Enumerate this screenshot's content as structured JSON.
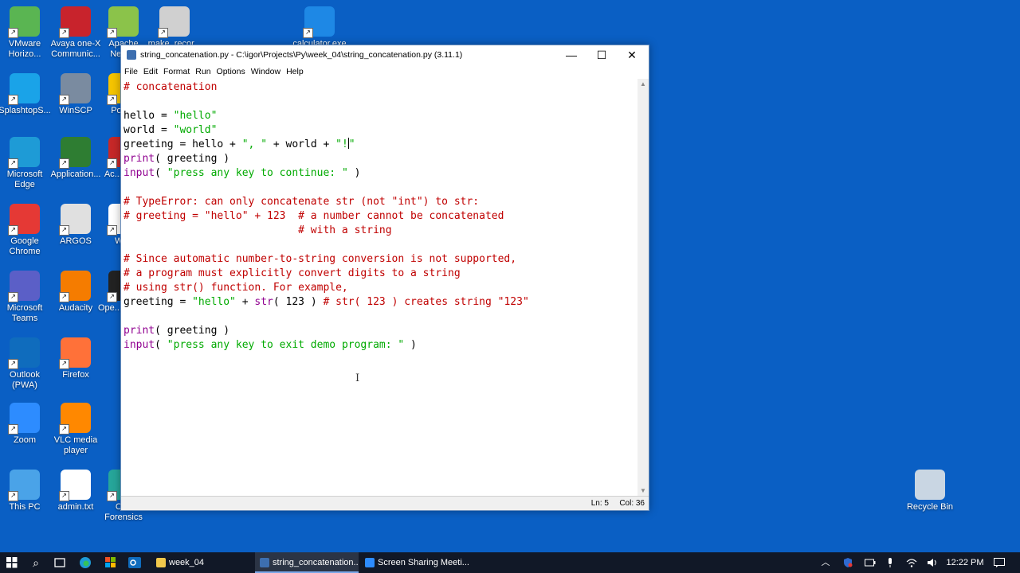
{
  "desktop": {
    "icons": [
      {
        "label": "VMware Horizo...",
        "color": "#5ab552"
      },
      {
        "label": "Avaya one-X Communic...",
        "color": "#c8232c"
      },
      {
        "label": "Apache NetB...",
        "color": "#8bc34a"
      },
      {
        "label": "make_recor...",
        "color": "#d0d0d0"
      },
      {
        "label": "calculator.exe",
        "color": "#1e88e5"
      },
      {
        "label": "SplashtopS...",
        "color": "#1aa3e8"
      },
      {
        "label": "WinSCP",
        "color": "#7a8ba0"
      },
      {
        "label": "PotP...",
        "color": "#f5c400"
      },
      {
        "label": "Microsoft Edge",
        "color": "#1e9bd6"
      },
      {
        "label": "Application...",
        "color": "#2e7d32"
      },
      {
        "label": "Ac... Re...",
        "color": "#c62828"
      },
      {
        "label": "Google Chrome",
        "color": "#e53935"
      },
      {
        "label": "ARGOS",
        "color": "#e0e0e0"
      },
      {
        "label": "Wi...",
        "color": "#ffffff"
      },
      {
        "label": "Microsoft Teams",
        "color": "#5b5fc7"
      },
      {
        "label": "Audacity",
        "color": "#f57c00"
      },
      {
        "label": "Ope... Vide...",
        "color": "#222222"
      },
      {
        "label": "Outlook (PWA)",
        "color": "#0f6cbd"
      },
      {
        "label": "Firefox",
        "color": "#ff7139"
      },
      {
        "label": "Zoom",
        "color": "#2d8cff"
      },
      {
        "label": "VLC media player",
        "color": "#ff8800"
      },
      {
        "label": "This PC",
        "color": "#4aa3e8"
      },
      {
        "label": "admin.txt",
        "color": "#ffffff"
      },
      {
        "label": "CI... Forensics",
        "color": "#26a69a"
      },
      {
        "label": "Recycle Bin",
        "color": "#c9d6e3"
      }
    ]
  },
  "window": {
    "title": "string_concatenation.py - C:\\igor\\Projects\\Py\\week_04\\string_concatenation.py (3.11.1)",
    "minimize": "—",
    "maximize": "☐",
    "close": "✕",
    "menu": [
      "File",
      "Edit",
      "Format",
      "Run",
      "Options",
      "Window",
      "Help"
    ]
  },
  "code_lines": [
    [
      {
        "t": "cm",
        "s": "# concatenation"
      }
    ],
    [],
    [
      {
        "t": "",
        "s": "hello = "
      },
      {
        "t": "st",
        "s": "\"hello\""
      }
    ],
    [
      {
        "t": "",
        "s": "world = "
      },
      {
        "t": "st",
        "s": "\"world\""
      }
    ],
    [
      {
        "t": "",
        "s": "greeting = hello + "
      },
      {
        "t": "st",
        "s": "\", \""
      },
      {
        "t": "",
        "s": " + world + "
      },
      {
        "t": "st",
        "s": "\"!"
      },
      {
        "t": "caret",
        "s": ""
      },
      {
        "t": "st",
        "s": "\""
      }
    ],
    [
      {
        "t": "bi",
        "s": "print"
      },
      {
        "t": "",
        "s": "( greeting )"
      }
    ],
    [
      {
        "t": "bi",
        "s": "input"
      },
      {
        "t": "",
        "s": "( "
      },
      {
        "t": "st",
        "s": "\"press any key to continue: \""
      },
      {
        "t": "",
        "s": " )"
      }
    ],
    [],
    [
      {
        "t": "cm",
        "s": "# TypeError: can only concatenate str (not \"int\") to str:"
      }
    ],
    [
      {
        "t": "cm",
        "s": "# greeting = \"hello\" + 123  # a number cannot be concatenated"
      }
    ],
    [
      {
        "t": "cm",
        "s": "                            # with a string"
      }
    ],
    [],
    [
      {
        "t": "cm",
        "s": "# Since automatic number-to-string conversion is not supported,"
      }
    ],
    [
      {
        "t": "cm",
        "s": "# a program must explicitly convert digits to a string"
      }
    ],
    [
      {
        "t": "cm",
        "s": "# using str() function. For example,"
      }
    ],
    [
      {
        "t": "",
        "s": "greeting = "
      },
      {
        "t": "st",
        "s": "\"hello\""
      },
      {
        "t": "",
        "s": " + "
      },
      {
        "t": "bi",
        "s": "str"
      },
      {
        "t": "",
        "s": "( 123 ) "
      },
      {
        "t": "cm",
        "s": "# str( 123 ) creates string \"123\""
      }
    ],
    [],
    [
      {
        "t": "bi",
        "s": "print"
      },
      {
        "t": "",
        "s": "( greeting )"
      }
    ],
    [
      {
        "t": "bi",
        "s": "input"
      },
      {
        "t": "",
        "s": "( "
      },
      {
        "t": "st",
        "s": "\"press any key to exit demo program: \""
      },
      {
        "t": "",
        "s": " )"
      }
    ]
  ],
  "status": {
    "line": "Ln: 5",
    "col": "Col: 36"
  },
  "taskbar": {
    "search_icon": "⌕",
    "apps": [
      {
        "label": "week_04",
        "color": "#f2c94c"
      },
      {
        "label": "string_concatenation....",
        "color": "#3d6fb0"
      },
      {
        "label": "Screen Sharing Meeti...",
        "color": "#2d8cff"
      }
    ],
    "time": "12:22 PM"
  }
}
